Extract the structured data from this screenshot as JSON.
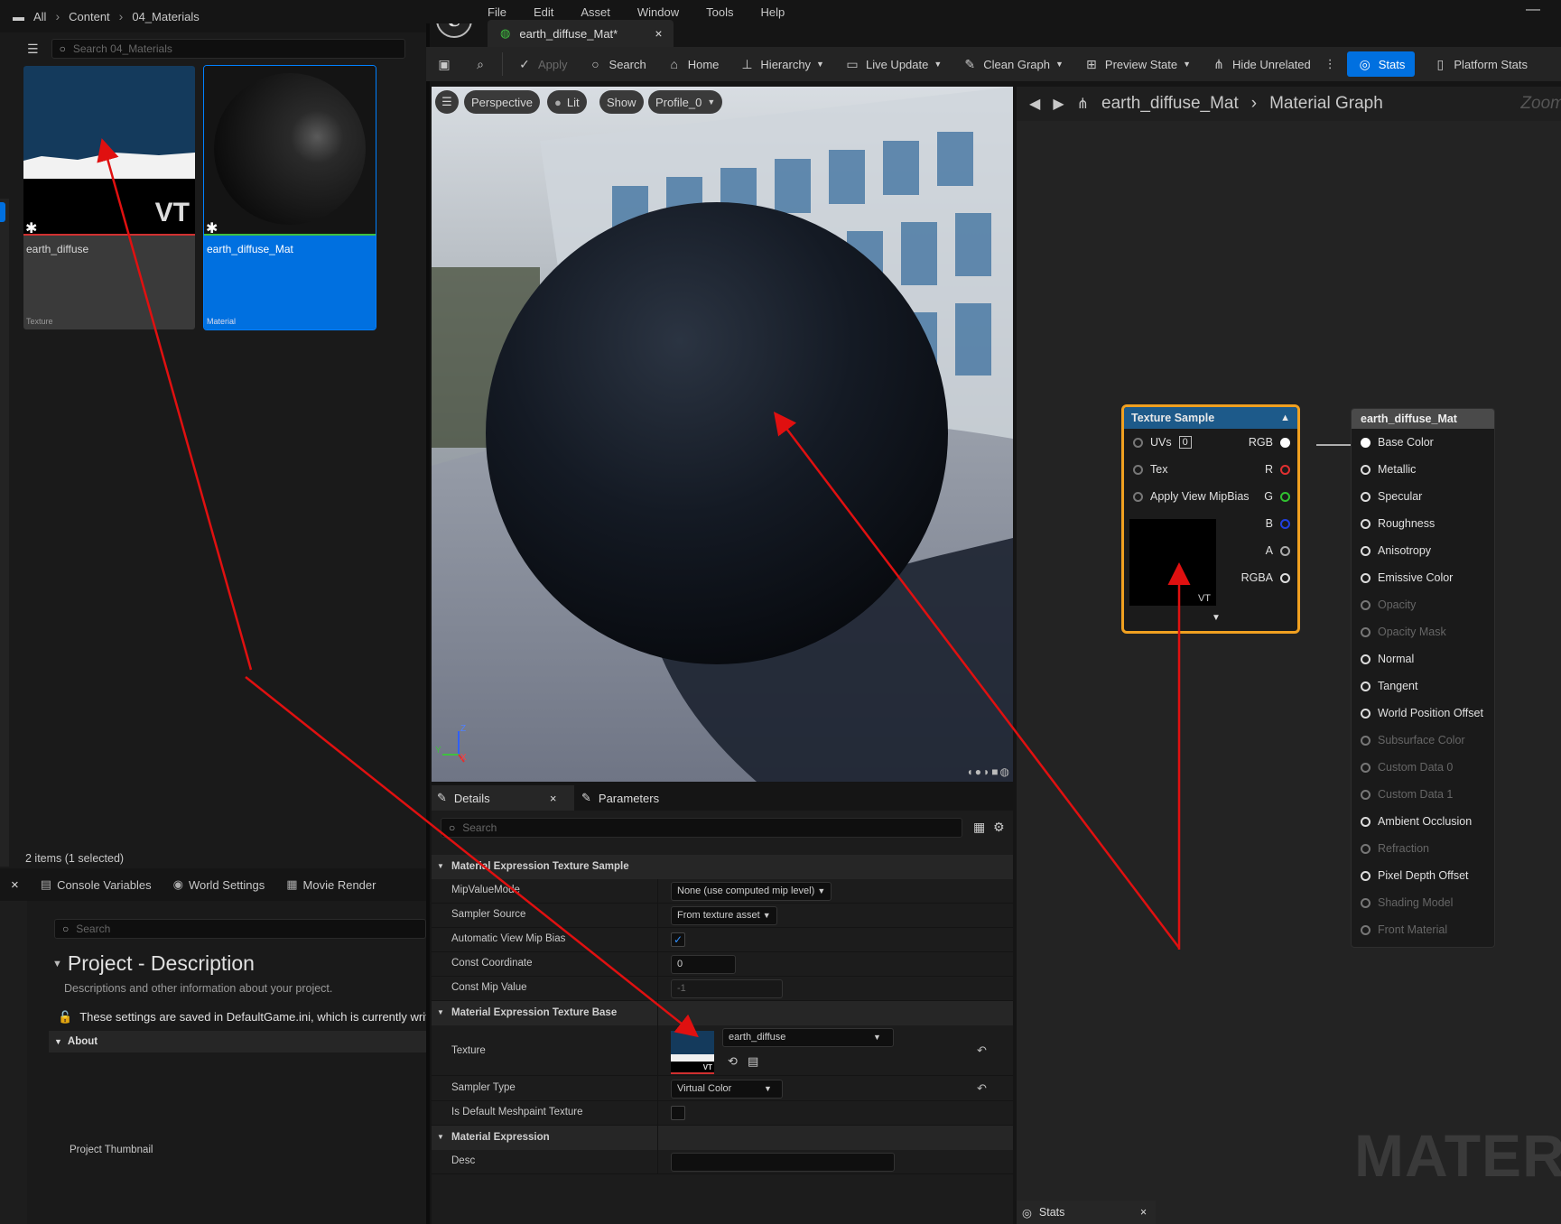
{
  "content_browser": {
    "breadcrumb": [
      "All",
      "Content",
      "04_Materials"
    ],
    "search_placeholder": "Search 04_Materials",
    "assets": [
      {
        "name": "earth_diffuse",
        "type": "Texture",
        "badge": "VT"
      },
      {
        "name": "earth_diffuse_Mat",
        "type": "Material"
      }
    ],
    "status": "2 items (1 selected)"
  },
  "bottom_left": {
    "close": "×",
    "tabs": [
      "Console Variables",
      "World Settings",
      "Movie Render"
    ],
    "search_placeholder": "Search",
    "title": "Project - Description",
    "subtitle": "Descriptions and other information about your project.",
    "notice": "These settings are saved in DefaultGame.ini, which is currently writ",
    "section": "About",
    "thumbnail_label": "Project Thumbnail"
  },
  "menu": [
    "File",
    "Edit",
    "Asset",
    "Window",
    "Tools",
    "Help"
  ],
  "doc_tab": {
    "label": "earth_diffuse_Mat*",
    "close": "×"
  },
  "toolbar": {
    "apply": "Apply",
    "search": "Search",
    "home": "Home",
    "hierarchy": "Hierarchy",
    "live_update": "Live Update",
    "clean_graph": "Clean Graph",
    "preview_state": "Preview State",
    "hide_unrelated": "Hide Unrelated",
    "stats": "Stats",
    "platform_stats": "Platform Stats"
  },
  "viewport": {
    "perspective": "Perspective",
    "lit": "Lit",
    "show": "Show",
    "profile": "Profile_0",
    "axis_z": "Z",
    "axis_x": "X",
    "axis_y": "Y"
  },
  "details": {
    "tab_details": "Details",
    "tab_close": "×",
    "tab_parameters": "Parameters",
    "search_placeholder": "Search",
    "sections": {
      "sample": "Material Expression Texture Sample",
      "base": "Material Expression Texture Base",
      "expr": "Material Expression"
    },
    "mip_value_mode": {
      "label": "MipValueMode",
      "value": "None (use computed mip level)"
    },
    "sampler_source": {
      "label": "Sampler Source",
      "value": "From texture asset"
    },
    "auto_mip": {
      "label": "Automatic View Mip Bias",
      "checked": true
    },
    "const_coord": {
      "label": "Const Coordinate",
      "value": "0"
    },
    "const_mip": {
      "label": "Const Mip Value",
      "value": "-1"
    },
    "texture": {
      "label": "Texture",
      "value": "earth_diffuse",
      "badge": "VT"
    },
    "sampler_type": {
      "label": "Sampler Type",
      "value": "Virtual Color"
    },
    "default_meshpaint": {
      "label": "Is Default Meshpaint Texture",
      "checked": false
    },
    "desc": {
      "label": "Desc",
      "value": ""
    }
  },
  "graph": {
    "breadcrumb_asset": "earth_diffuse_Mat",
    "breadcrumb_graph": "Material Graph",
    "zoom": "Zoom",
    "texture_node": {
      "title": "Texture Sample",
      "inputs": [
        "UVs",
        "Tex",
        "Apply View MipBias"
      ],
      "uv_value": "0",
      "outputs": [
        "RGB",
        "R",
        "G",
        "B",
        "A",
        "RGBA"
      ],
      "badge": "VT"
    },
    "material_node": {
      "title": "earth_diffuse_Mat",
      "pins": [
        {
          "label": "Base Color",
          "active": true
        },
        {
          "label": "Metallic",
          "active": true
        },
        {
          "label": "Specular",
          "active": true
        },
        {
          "label": "Roughness",
          "active": true
        },
        {
          "label": "Anisotropy",
          "active": true
        },
        {
          "label": "Emissive Color",
          "active": true
        },
        {
          "label": "Opacity",
          "active": false
        },
        {
          "label": "Opacity Mask",
          "active": false
        },
        {
          "label": "Normal",
          "active": true
        },
        {
          "label": "Tangent",
          "active": true
        },
        {
          "label": "World Position Offset",
          "active": true
        },
        {
          "label": "Subsurface Color",
          "active": false
        },
        {
          "label": "Custom Data 0",
          "active": false
        },
        {
          "label": "Custom Data 1",
          "active": false
        },
        {
          "label": "Ambient Occlusion",
          "active": true
        },
        {
          "label": "Refraction",
          "active": false
        },
        {
          "label": "Pixel Depth Offset",
          "active": true
        },
        {
          "label": "Shading Model",
          "active": false
        },
        {
          "label": "Front Material",
          "active": false
        }
      ]
    },
    "watermark": "MATERIA",
    "stats_tab": "Stats",
    "stats_close": "×"
  },
  "colors": {
    "accent": "#0070e0",
    "node_select": "#f0a020",
    "annotation": "#e01010"
  }
}
